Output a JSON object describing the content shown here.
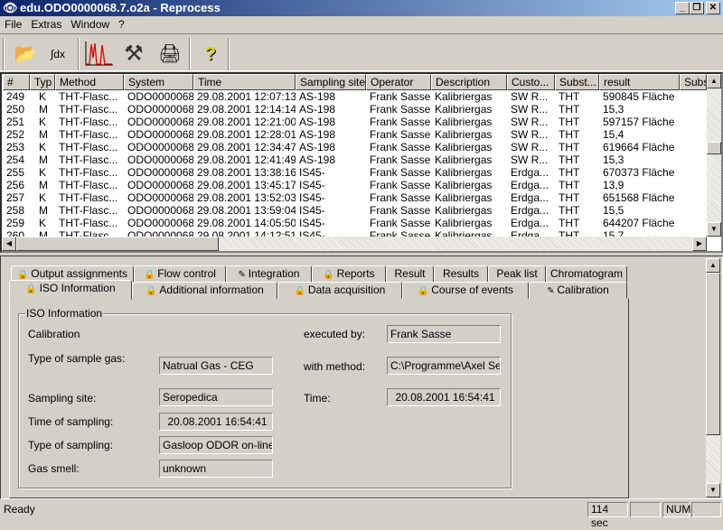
{
  "window": {
    "title": "edu.ODO0000068.7.o2a - Reprocess",
    "minimize": "_",
    "maximize": "❐",
    "close": "✕"
  },
  "menu": [
    "File",
    "Extras",
    "Window",
    "?"
  ],
  "toolbar": [
    {
      "icon": "open-folder-icon",
      "glyph": "📂"
    },
    {
      "icon": "integral-icon",
      "glyph": "∫dx"
    },
    {
      "icon": "chromatogram-icon",
      "glyph": ""
    },
    {
      "icon": "tools-icon",
      "glyph": "⚒"
    },
    {
      "icon": "print-preview-icon",
      "glyph": "🖨"
    },
    {
      "icon": "help-icon",
      "glyph": "?"
    }
  ],
  "table": {
    "columns": [
      "#",
      "Typ",
      "Method",
      "System",
      "Time",
      "Sampling site",
      "Operator",
      "Description",
      "Custo...",
      "Subst...",
      "result",
      "Subs"
    ],
    "sort_indicator": "△",
    "rows": [
      [
        "249",
        "K",
        "THT-Flasc...",
        "ODO0000068",
        "29.08.2001 12:07:13",
        "AS-198",
        "Frank Sasse",
        "Kalibriergas",
        "SW R...",
        "THT",
        "590845 Fläche"
      ],
      [
        "250",
        "M",
        "THT-Flasc...",
        "ODO0000068",
        "29.08.2001 12:14:14",
        "AS-198",
        "Frank Sasse",
        "Kalibriergas",
        "SW R...",
        "THT",
        "15,3"
      ],
      [
        "251",
        "K",
        "THT-Flasc...",
        "ODO0000068",
        "29.08.2001 12:21:00",
        "AS-198",
        "Frank Sasse",
        "Kalibriergas",
        "SW R...",
        "THT",
        "597157 Fläche"
      ],
      [
        "252",
        "M",
        "THT-Flasc...",
        "ODO0000068",
        "29.08.2001 12:28:01",
        "AS-198",
        "Frank Sasse",
        "Kalibriergas",
        "SW R...",
        "THT",
        "15,4"
      ],
      [
        "253",
        "K",
        "THT-Flasc...",
        "ODO0000068",
        "29.08.2001 12:34:47",
        "AS-198",
        "Frank Sasse",
        "Kalibriergas",
        "SW R...",
        "THT",
        "619664 Fläche"
      ],
      [
        "254",
        "M",
        "THT-Flasc...",
        "ODO0000068",
        "29.08.2001 12:41:49",
        "AS-198",
        "Frank Sasse",
        "Kalibriergas",
        "SW R...",
        "THT",
        "15,3"
      ],
      [
        "255",
        "K",
        "THT-Flasc...",
        "ODO0000068",
        "29.08.2001 13:38:16",
        "IS45-",
        "Frank Sasse",
        "Kalibriergas",
        "Erdga...",
        "THT",
        "670373 Fläche"
      ],
      [
        "256",
        "M",
        "THT-Flasc...",
        "ODO0000068",
        "29.08.2001 13:45:17",
        "IS45-",
        "Frank Sasse",
        "Kalibriergas",
        "Erdga...",
        "THT",
        "13,9"
      ],
      [
        "257",
        "K",
        "THT-Flasc...",
        "ODO0000068",
        "29.08.2001 13:52:03",
        "IS45-",
        "Frank Sasse",
        "Kalibriergas",
        "Erdga...",
        "THT",
        "651568 Fläche"
      ],
      [
        "258",
        "M",
        "THT-Flasc...",
        "ODO0000068",
        "29.08.2001 13:59:04",
        "IS45-",
        "Frank Sasse",
        "Kalibriergas",
        "Erdga...",
        "THT",
        "15,5"
      ],
      [
        "259",
        "K",
        "THT-Flasc...",
        "ODO0000068",
        "29.08.2001 14:05:50",
        "IS45-",
        "Frank Sasse",
        "Kalibriergas",
        "Erdga...",
        "THT",
        "644207 Fläche"
      ],
      [
        "260",
        "M",
        "THT-Flasc...",
        "ODO0000068",
        "29.08.2001 14:12:51",
        "IS45-",
        "Frank Sasse",
        "Kalibriergas",
        "Erdga...",
        "THT",
        "15,7"
      ]
    ]
  },
  "tabs_row1": [
    {
      "label": "Output assignments",
      "icon": "lock"
    },
    {
      "label": "Flow control",
      "icon": "lock"
    },
    {
      "label": "Integration",
      "icon": "pencil"
    },
    {
      "label": "Reports",
      "icon": "lock"
    },
    {
      "label": "Result",
      "icon": ""
    },
    {
      "label": "Results",
      "icon": ""
    },
    {
      "label": "Peak list",
      "icon": ""
    },
    {
      "label": "Chromatogram",
      "icon": ""
    }
  ],
  "tabs_row2": [
    {
      "label": "ISO Information",
      "icon": "lock",
      "active": true
    },
    {
      "label": "Additional information",
      "icon": "lock"
    },
    {
      "label": "Data acquisition",
      "icon": "lock"
    },
    {
      "label": "Course of events",
      "icon": "lock"
    },
    {
      "label": "Calibration",
      "icon": "pencil"
    }
  ],
  "iso": {
    "group_title": "ISO Information",
    "calibration": "Calibration",
    "executed_by_label": "executed by:",
    "executed_by": "Frank Sasse",
    "sample_gas_label": "Type of sample gas:",
    "sample_gas": "Natrual Gas - CEG",
    "with_method_label": "with method:",
    "with_method": "C:\\Programme\\Axel Semr",
    "sampling_site_label": "Sampling site:",
    "sampling_site": "Seropedica",
    "time_label": "Time:",
    "time": "20.08.2001 16:54:41",
    "time_of_sampling_label": "Time of sampling:",
    "time_of_sampling": "20.08.2001 16:54:41",
    "type_of_sampling_label": "Type of sampling:",
    "type_of_sampling": "Gasloop ODOR on-line",
    "gas_smell_label": "Gas smell:",
    "gas_smell": "unknown"
  },
  "status": {
    "text": "Ready",
    "timer": "114 sec",
    "num": "NUM"
  }
}
